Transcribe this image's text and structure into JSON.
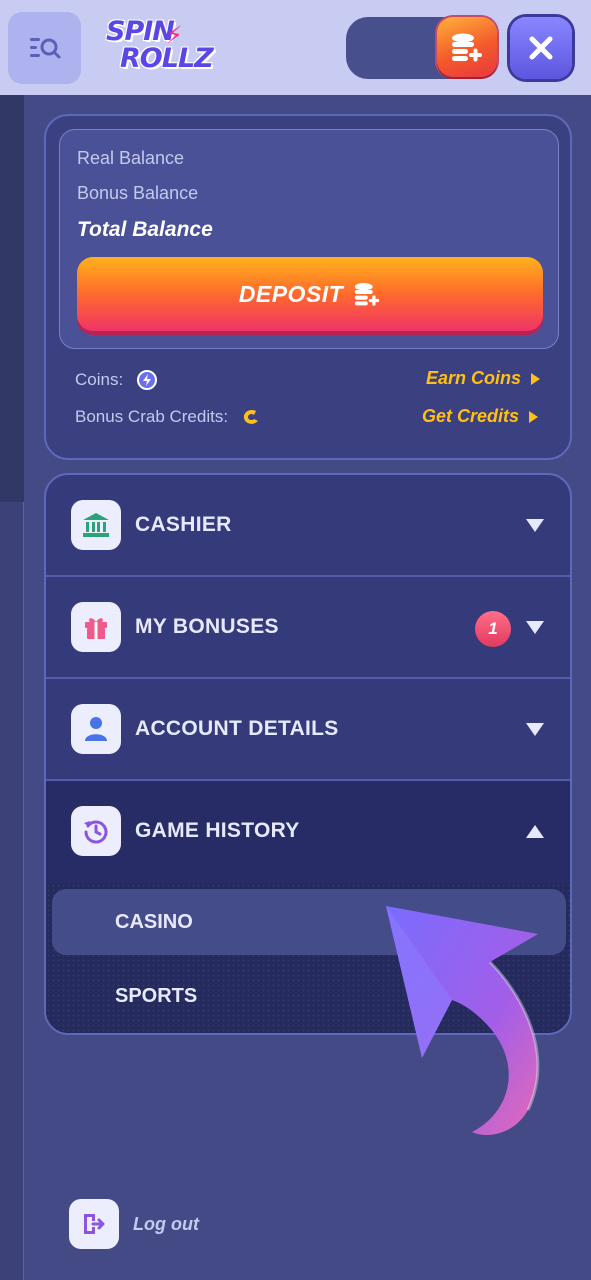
{
  "header": {
    "logo_line1": "SPIN",
    "logo_line2": "ROLLZ"
  },
  "balance": {
    "real_label": "Real Balance",
    "bonus_label": "Bonus Balance",
    "total_label": "Total Balance",
    "deposit_label": "DEPOSIT",
    "coins_label": "Coins:",
    "earn_coins": "Earn Coins",
    "credits_label": "Bonus Crab Credits:",
    "get_credits": "Get Credits"
  },
  "menu": {
    "items": [
      {
        "label": "CASHIER",
        "icon": "bank-icon"
      },
      {
        "label": "MY BONUSES",
        "icon": "gift-icon",
        "badge": "1"
      },
      {
        "label": "ACCOUNT DETAILS",
        "icon": "user-icon"
      },
      {
        "label": "GAME HISTORY",
        "icon": "history-icon"
      }
    ],
    "submenu": [
      "CASINO",
      "SPORTS"
    ]
  },
  "logout": {
    "label": "Log out"
  },
  "colors": {
    "accent_gold": "#ffbf16",
    "deposit_gradient_top": "#ffb21c",
    "deposit_gradient_bottom": "#ef3466",
    "badge": "#e13a60"
  }
}
